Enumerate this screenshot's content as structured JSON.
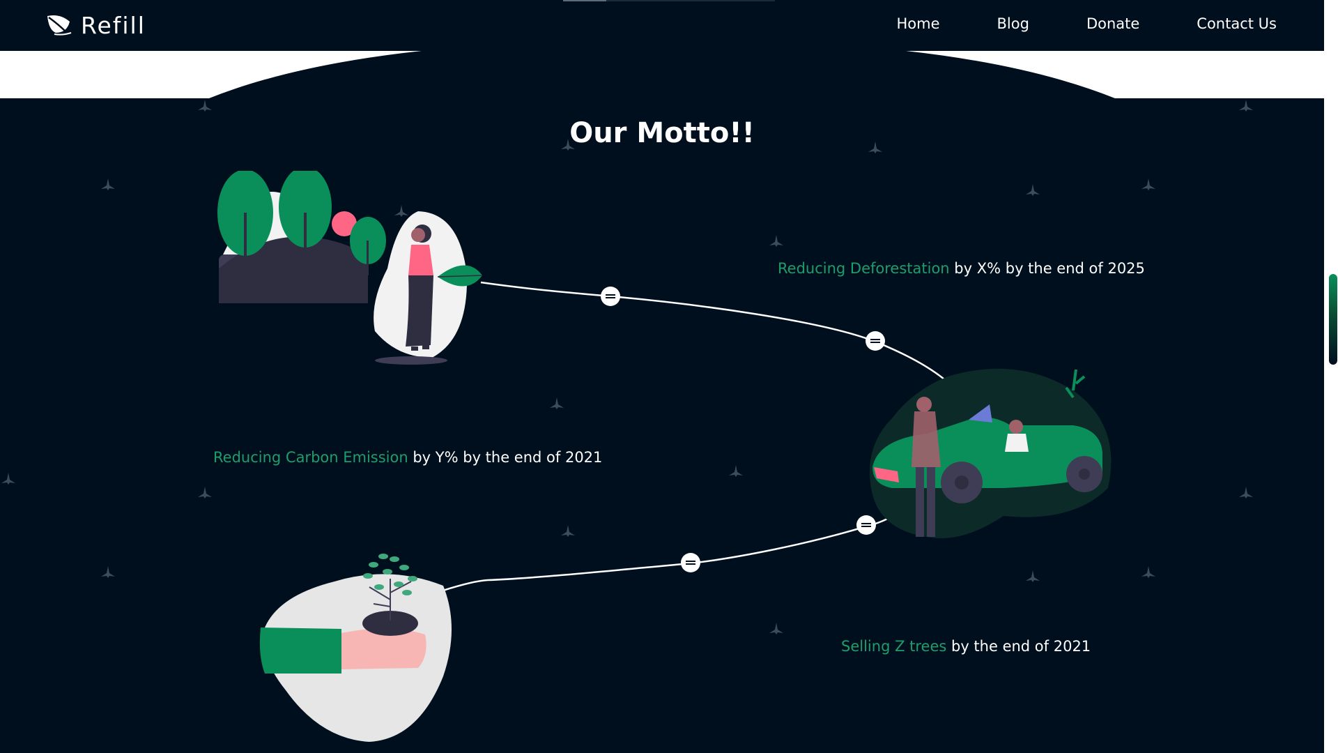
{
  "brand": {
    "name": "Refill",
    "logo_icon": "leaf-icon"
  },
  "nav": {
    "items": [
      "Home",
      "Blog",
      "Donate",
      "Contact Us"
    ]
  },
  "section": {
    "title": "Our Motto!!"
  },
  "mottos": [
    {
      "highlight": "Reducing Deforestation",
      "rest": " by X% by the end of 2025"
    },
    {
      "highlight": "Reducing Carbon Emission",
      "rest": " by Y% by the end of 2021"
    },
    {
      "highlight": "Selling Z trees",
      "rest": " by the end of 2021"
    }
  ],
  "colors": {
    "background": "#000f1e",
    "accent": "#1f9d6a",
    "text": "#ffffff",
    "band": "#ffffff"
  },
  "illustrations": [
    "woman-with-trees-illustration",
    "convertible-car-illustration",
    "hands-holding-plant-illustration"
  ]
}
